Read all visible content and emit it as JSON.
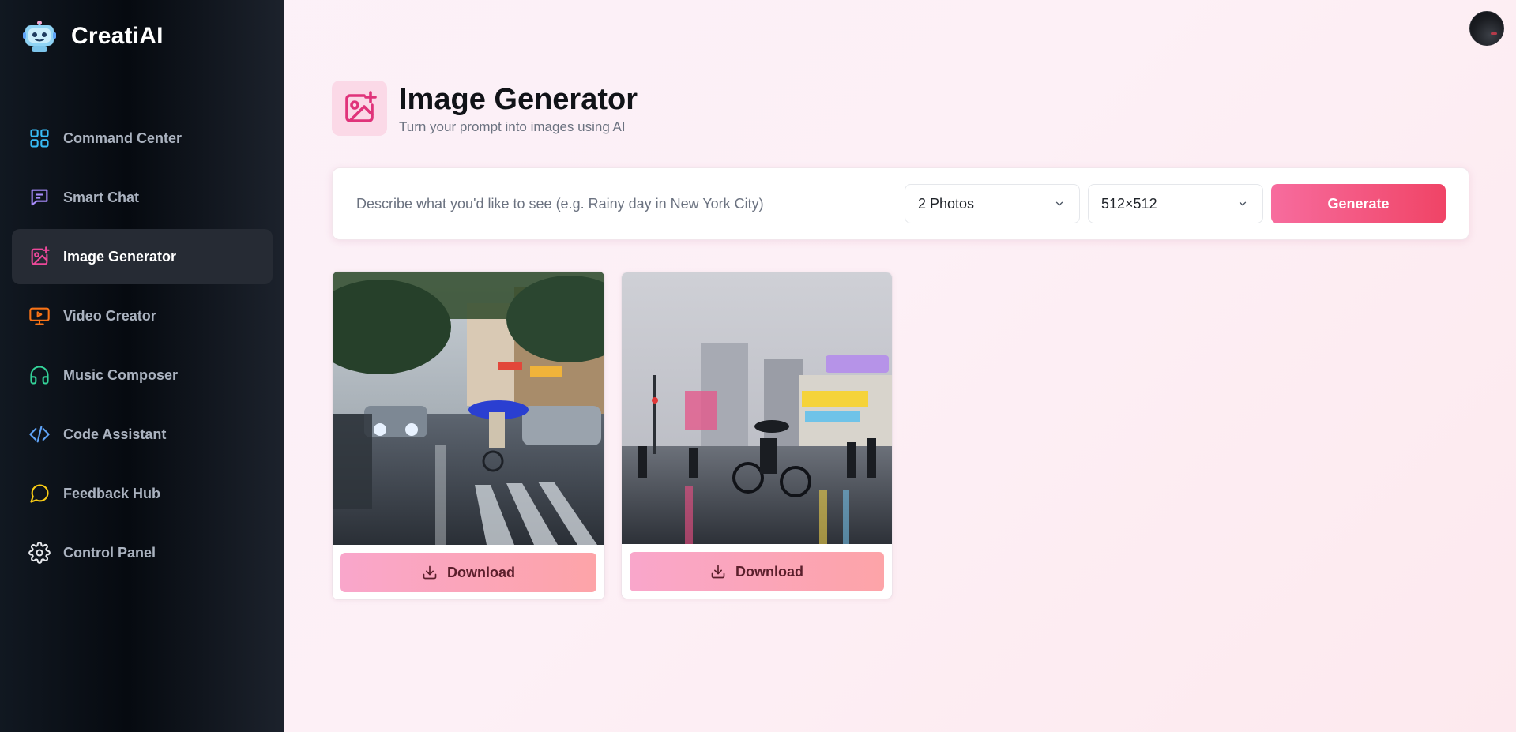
{
  "app": {
    "name": "CreatiAI",
    "accent": "#f04466",
    "sidebar_bg": "#0b0f15"
  },
  "sidebar": {
    "items": [
      {
        "label": "Command Center",
        "icon": "grid-icon",
        "color": "#38bdf8",
        "active": false
      },
      {
        "label": "Smart Chat",
        "icon": "chat-icon",
        "color": "#a78bfa",
        "active": false
      },
      {
        "label": "Image Generator",
        "icon": "image-plus-icon",
        "color": "#ec4899",
        "active": true
      },
      {
        "label": "Video Creator",
        "icon": "monitor-play-icon",
        "color": "#f97316",
        "active": false
      },
      {
        "label": "Music Composer",
        "icon": "headphones-icon",
        "color": "#34d399",
        "active": false
      },
      {
        "label": "Code Assistant",
        "icon": "code-icon",
        "color": "#60a5fa",
        "active": false
      },
      {
        "label": "Feedback Hub",
        "icon": "message-circle-icon",
        "color": "#facc15",
        "active": false
      },
      {
        "label": "Control Panel",
        "icon": "gear-icon",
        "color": "#e5e7eb",
        "active": false
      }
    ]
  },
  "header": {
    "title": "Image Generator",
    "subtitle": "Turn your prompt into images using AI"
  },
  "prompt": {
    "placeholder": "Describe what you'd like to see (e.g. Rainy day in New York City)",
    "value": "",
    "count": {
      "value": "2 Photos"
    },
    "size": {
      "value": "512×512"
    },
    "generate_label": "Generate"
  },
  "results": {
    "images": [
      {
        "description_icon": "image",
        "download_label": "Download"
      },
      {
        "description_icon": "image",
        "download_label": "Download"
      }
    ]
  }
}
